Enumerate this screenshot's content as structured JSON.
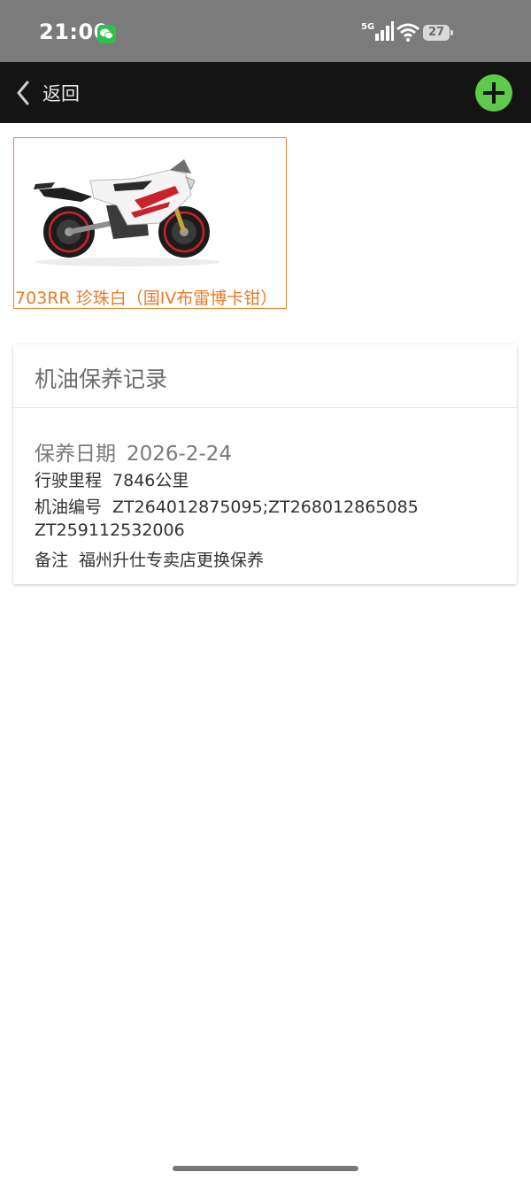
{
  "status_bar": {
    "time": "21:00",
    "network": "5G",
    "battery": "27"
  },
  "nav": {
    "back_label": "返回"
  },
  "bike": {
    "name": "703RR 珍珠白（国IV布雷博卡钳）"
  },
  "record": {
    "title": "机油保养记录",
    "date_label": "保养日期",
    "date_value": "2026-2-24",
    "mileage_label": "行驶里程",
    "mileage_value": "7846公里",
    "oil_label": "机油编号",
    "oil_value_line1": "ZT264012875095;ZT268012865085",
    "oil_value_line2": "ZT259112532006",
    "note_label": "备注",
    "note_value": "福州升仕专卖店更换保养"
  },
  "colors": {
    "accent_orange": "#e57c28",
    "add_button_green": "#5ec94b",
    "nav_background": "#141414"
  }
}
